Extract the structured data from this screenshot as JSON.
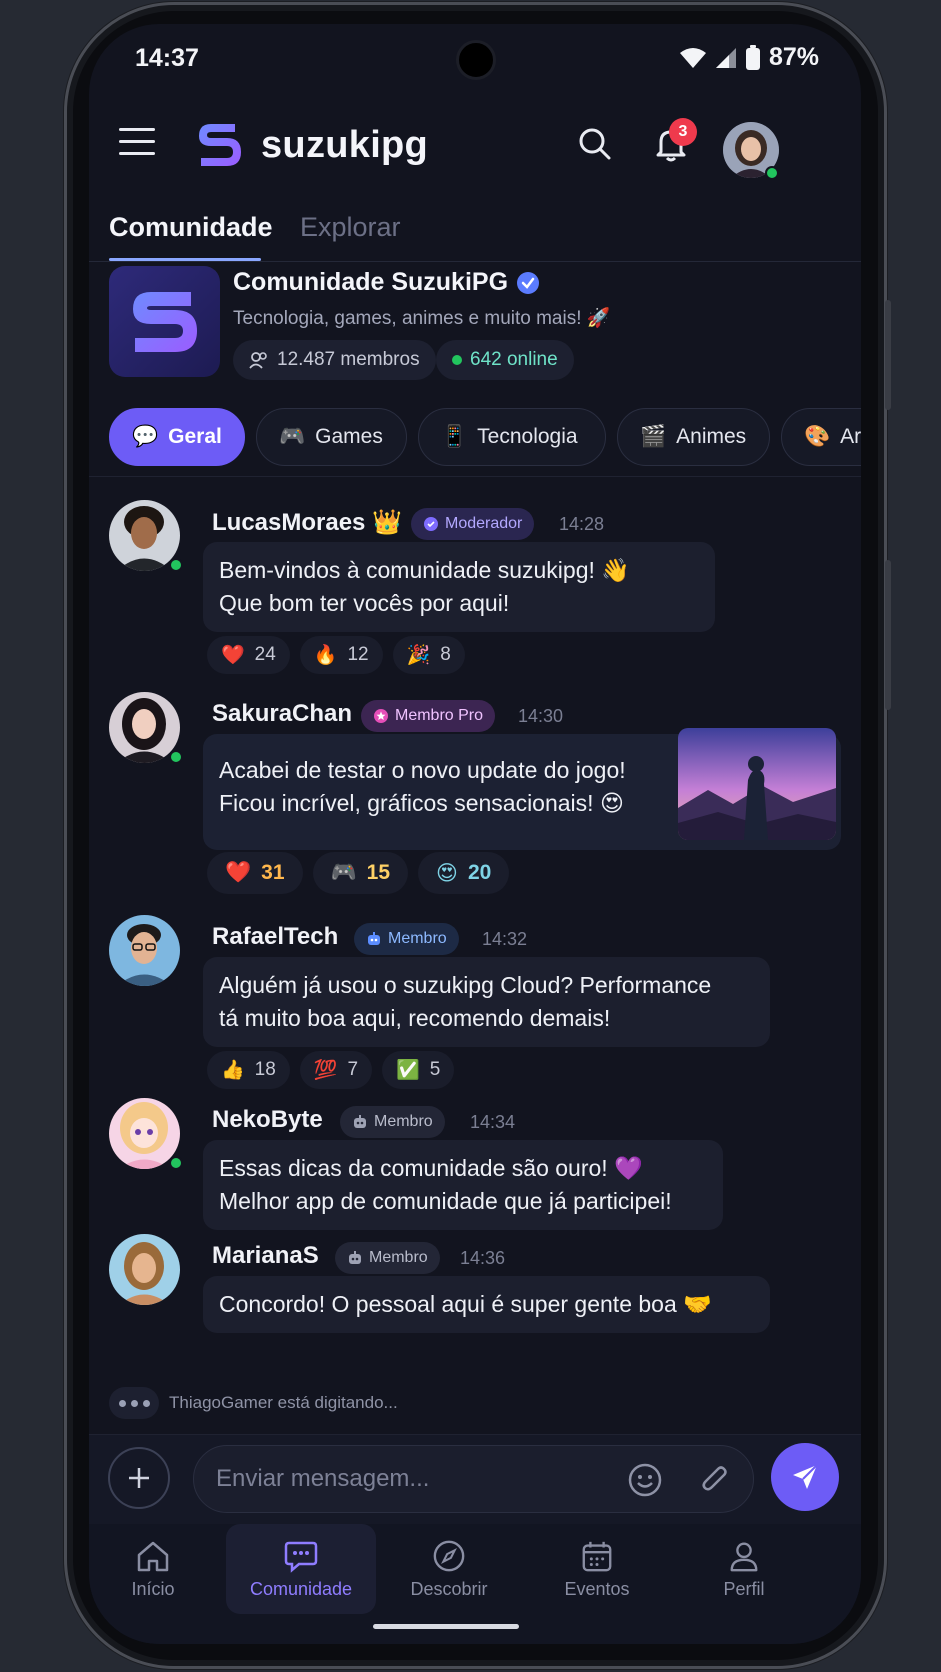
{
  "status_bar": {
    "time": "14:37",
    "battery": "87%"
  },
  "header": {
    "brand": "suzukipg",
    "notification_count": "3"
  },
  "tabs": [
    {
      "label": "Comunidade",
      "active": true
    },
    {
      "label": "Explorar",
      "active": false
    }
  ],
  "community": {
    "name": "Comunidade SuzukiPG",
    "description": "Tecnologia, games, animes e muito mais! 🚀",
    "members": "12.487 membros",
    "online": "642 online"
  },
  "channels": [
    {
      "emoji": "💬",
      "label": "Geral",
      "active": true
    },
    {
      "emoji": "🎮",
      "label": "Games",
      "active": false
    },
    {
      "emoji": "📱",
      "label": "Tecnologia",
      "active": false
    },
    {
      "emoji": "🎬",
      "label": "Animes",
      "active": false
    },
    {
      "emoji": "🎨",
      "label": "Arte",
      "active": false
    }
  ],
  "messages": [
    {
      "user": "LucasMoraes",
      "user_emoji": "👑",
      "role": "Moderador",
      "time": "14:28",
      "line1": "Bem-vindos à comunidade suzukipg! 👋",
      "line2": "Que bom ter vocês por aqui!",
      "reactions": [
        {
          "emoji": "❤️",
          "count": "24"
        },
        {
          "emoji": "🔥",
          "count": "12"
        },
        {
          "emoji": "🎉",
          "count": "8"
        }
      ]
    },
    {
      "user": "SakuraChan",
      "role": "Membro Pro",
      "time": "14:30",
      "line1": "Acabei de testar o novo update do jogo!",
      "line2": "Ficou incrível, gráficos sensacionais! 😍",
      "reactions": [
        {
          "emoji": "❤️",
          "count": "31"
        },
        {
          "emoji": "🎮",
          "count": "15"
        },
        {
          "emoji": "😍",
          "count": "20"
        }
      ]
    },
    {
      "user": "RafaelTech",
      "role": "Membro",
      "time": "14:32",
      "line1": "Alguém já usou o suzukipg Cloud? Performance",
      "line2": "tá muito boa aqui, recomendo demais!",
      "reactions": [
        {
          "emoji": "👍",
          "count": "18"
        },
        {
          "emoji": "💯",
          "count": "7"
        },
        {
          "emoji": "✅",
          "count": "5"
        }
      ]
    },
    {
      "user": "NekoByte",
      "role": "Membro",
      "time": "14:34",
      "line1": "Essas dicas da comunidade são ouro! 💜",
      "line2": "Melhor app de comunidade que já participei!"
    },
    {
      "user": "MarianaS",
      "role": "Membro",
      "time": "14:36",
      "line1": "Concordo! O pessoal aqui é super gente boa 🤝"
    }
  ],
  "typing_indicator": "ThiagoGamer está digitando...",
  "composer": {
    "placeholder": "Enviar mensagem..."
  },
  "bottom_nav": [
    {
      "label": "Início",
      "icon": "home-icon",
      "active": false
    },
    {
      "label": "Comunidade",
      "icon": "chat-icon",
      "active": true
    },
    {
      "label": "Descobrir",
      "icon": "compass-icon",
      "active": false
    },
    {
      "label": "Eventos",
      "icon": "calendar-icon",
      "active": false
    },
    {
      "label": "Perfil",
      "icon": "user-icon",
      "active": false
    }
  ],
  "colors": {
    "accent": "#6d5cf6",
    "background": "#12141f",
    "online": "#22c55e",
    "badge": "#ef3a4d",
    "tab_underline": "#8aa7ff"
  }
}
